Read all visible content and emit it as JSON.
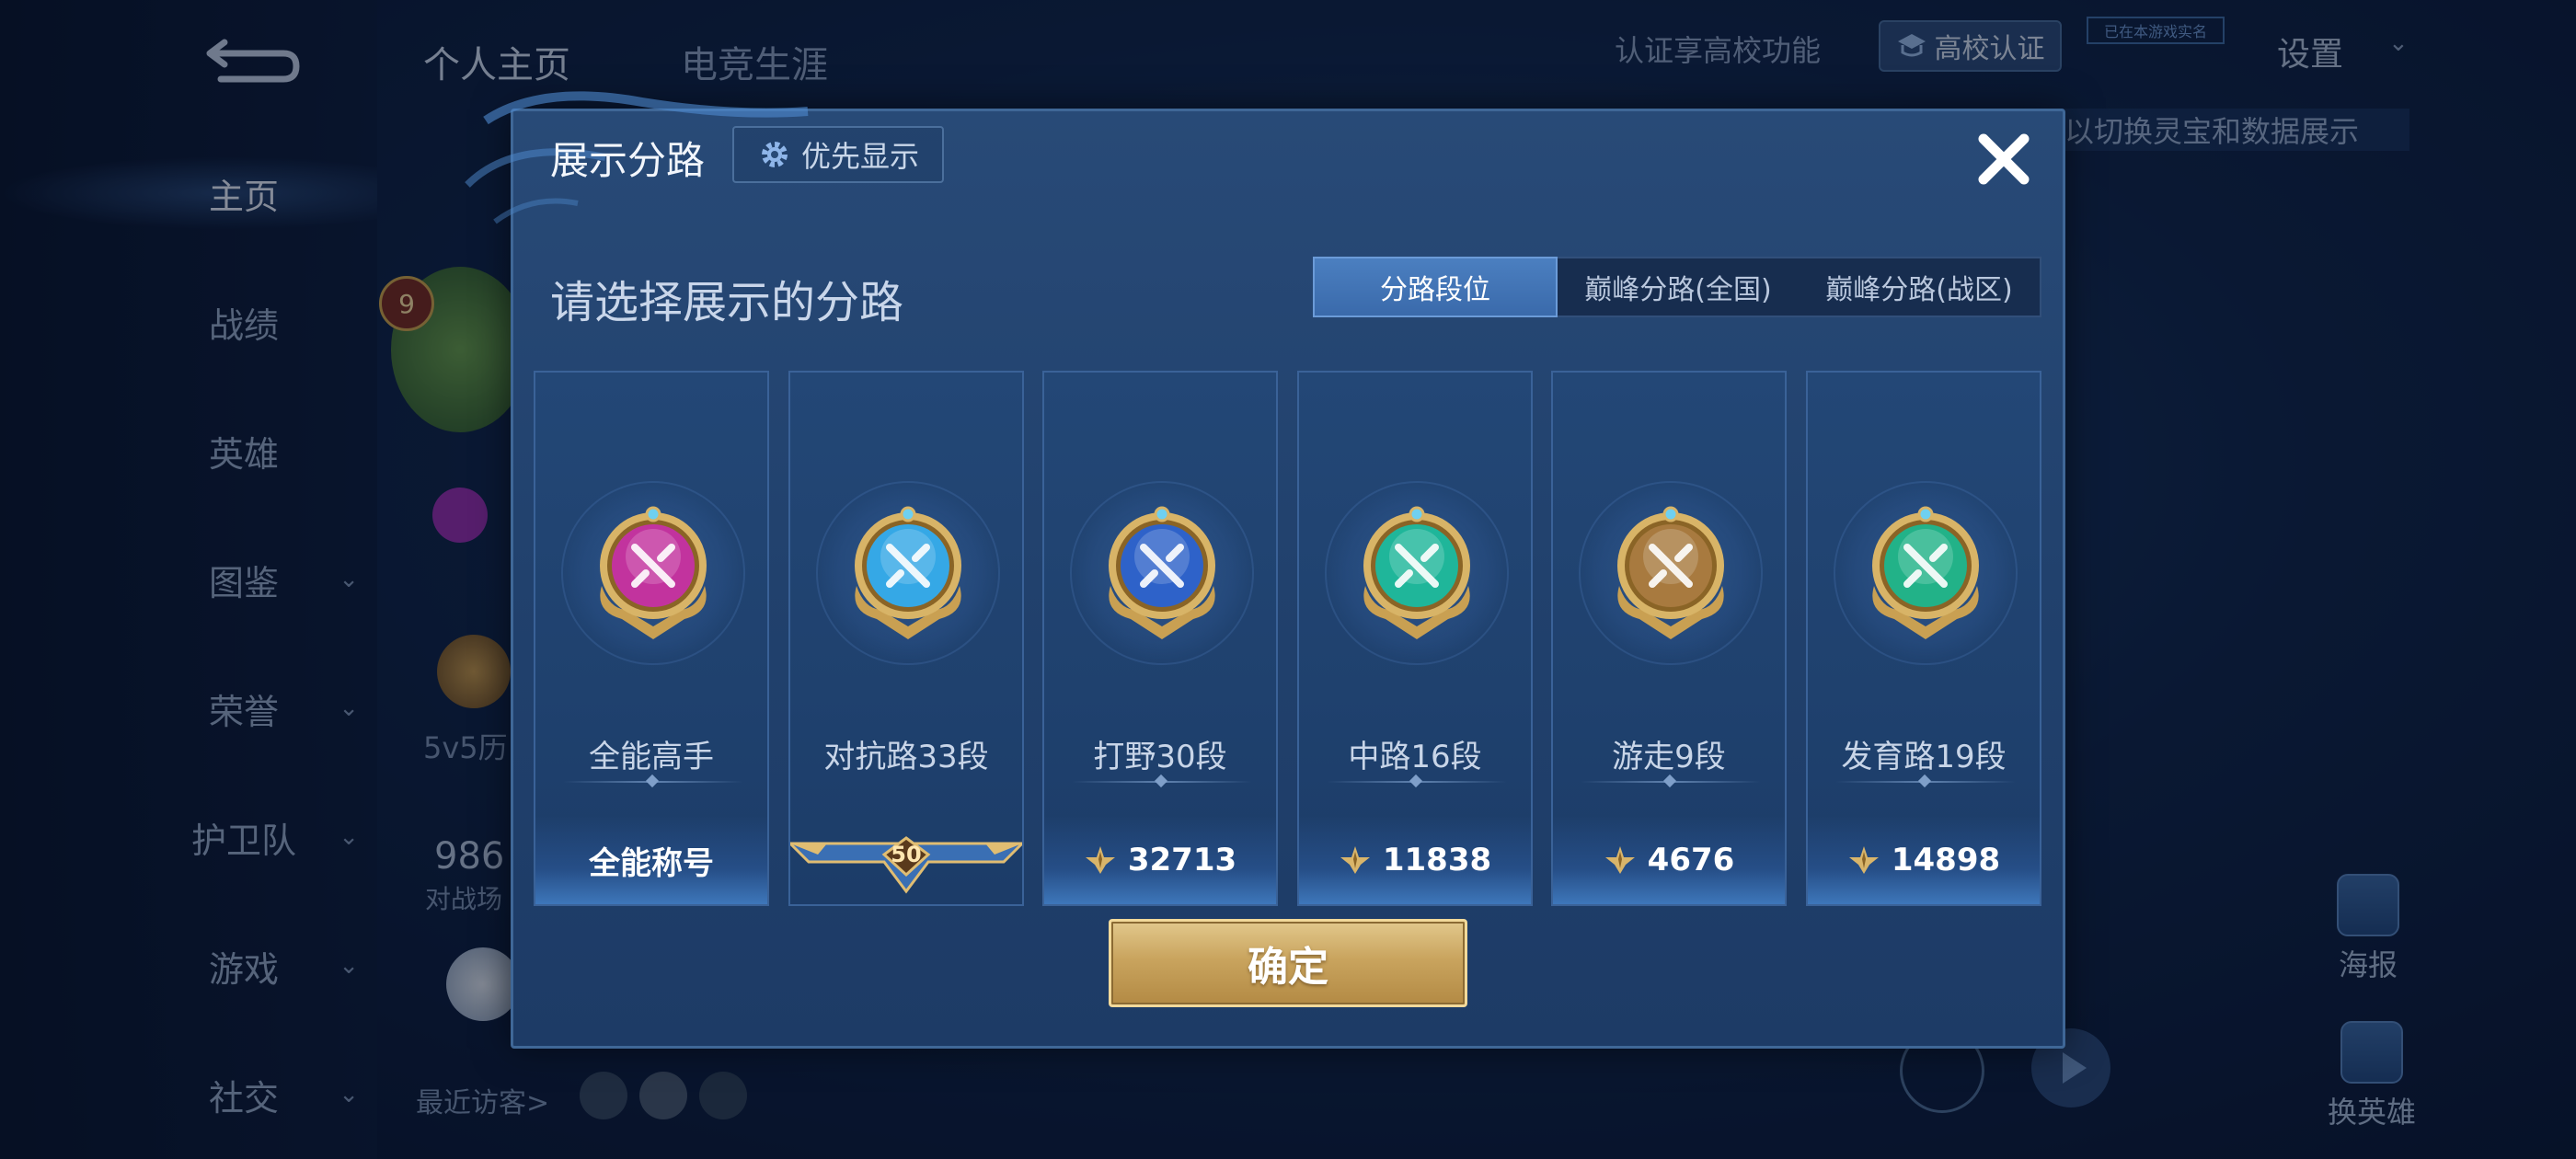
{
  "nav": {
    "items": [
      {
        "label": "主页",
        "active": true,
        "chevron": false
      },
      {
        "label": "战绩",
        "active": false,
        "chevron": false
      },
      {
        "label": "英雄",
        "active": false,
        "chevron": false
      },
      {
        "label": "图鉴",
        "active": false,
        "chevron": true
      },
      {
        "label": "荣誉",
        "active": false,
        "chevron": true
      },
      {
        "label": "护卫队",
        "active": false,
        "chevron": true
      },
      {
        "label": "游戏",
        "active": false,
        "chevron": true
      },
      {
        "label": "社交",
        "active": false,
        "chevron": true
      }
    ],
    "chevron_glyph": "⌄"
  },
  "top": {
    "tab_personal": "个人主页",
    "tab_esports": "电竞生涯",
    "verify_hint": "认证享高校功能",
    "school_verify": "高校认证",
    "tiny_badge": "已在本游戏实名",
    "settings": "设置",
    "settings_chevron": "⌄",
    "right_hint": "以切换灵宝和数据展示"
  },
  "background": {
    "level_badge": "9",
    "history_label": "5v5历",
    "number_partial": "986",
    "battle_label": "对战场",
    "recent_visitors": "最近访客>",
    "poster_label": "海报",
    "switch_hero_label": "换英雄"
  },
  "dialog": {
    "title": "展示分路",
    "priority_label": "优先显示",
    "close_glyph": "✕",
    "subtitle": "请选择展示的分路",
    "tabs": [
      {
        "label": "分路段位",
        "active": true
      },
      {
        "label": "巅峰分路(全国)",
        "active": false
      },
      {
        "label": "巅峰分路(战区)",
        "active": false
      }
    ],
    "cards": [
      {
        "name": "全能高手",
        "bottom_text": "全能称号",
        "emblem_color": "#c2339e",
        "emblem_icon": "allround-icon"
      },
      {
        "name": "对抗路33段",
        "bottom_text": "50",
        "emblem_color": "#35a8e6",
        "emblem_icon": "clash-lane-icon"
      },
      {
        "name": "打野30段",
        "bottom_text": "32713",
        "emblem_color": "#2e62c9",
        "emblem_icon": "jungle-icon"
      },
      {
        "name": "中路16段",
        "bottom_text": "11838",
        "emblem_color": "#1fb69a",
        "emblem_icon": "mid-lane-icon"
      },
      {
        "name": "游走9段",
        "bottom_text": "4676",
        "emblem_color": "#a87a3f",
        "emblem_icon": "roam-icon"
      },
      {
        "name": "发育路19段",
        "bottom_text": "14898",
        "emblem_color": "#22b288",
        "emblem_icon": "farm-lane-icon"
      }
    ],
    "confirm_label": "确定"
  },
  "colors": {
    "accent_blue": "#3a6aab",
    "gold": "#c9a45e",
    "dialog_bg": "#21416d"
  }
}
